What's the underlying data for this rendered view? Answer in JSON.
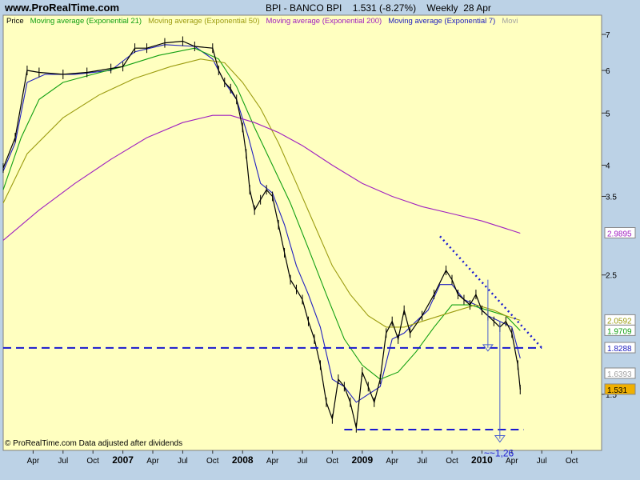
{
  "header": {
    "site": "www.ProRealTime.com",
    "title": "BPI - BANCO BPI    1.531 (-8.27%)    Weekly  28 Apr"
  },
  "legend": [
    {
      "label": "Price",
      "color": "#000000"
    },
    {
      "label": "Moving average (Exponential 21)",
      "color": "#12a012"
    },
    {
      "label": "Moving average (Exponential 50)",
      "color": "#9c9c10"
    },
    {
      "label": "Moving average (Exponential 200)",
      "color": "#a020c0"
    },
    {
      "label": "Moving average (Exponential 7)",
      "color": "#2020c0"
    },
    {
      "label": "Movi",
      "color": "#a0a0a0"
    }
  ],
  "footer": "© ProRealTime.com  Data adjusted after dividends",
  "annotation": "~~1,26",
  "price_tags": [
    {
      "label": "2.9895",
      "value": 2.9895,
      "fill": "#ffffff",
      "color": "#a020c0"
    },
    {
      "label": "2.0592",
      "value": 2.0592,
      "fill": "#ffffff",
      "color": "#9c9c10"
    },
    {
      "label": "1.9709",
      "value": 1.9709,
      "fill": "#ffffff",
      "color": "#12a012"
    },
    {
      "label": "1.8288",
      "value": 1.8288,
      "fill": "#ffffff",
      "color": "#2020c0"
    },
    {
      "label": "1.6393",
      "value": 1.6393,
      "fill": "#ffffff",
      "color": "#a0a0a0"
    },
    {
      "label": "1.531",
      "value": 1.531,
      "fill": "#f0b000",
      "color": "#000000"
    }
  ],
  "colors": {
    "background": "#ffffc0",
    "frame": "#bcd2e6",
    "annotation": "#1a1ad0"
  },
  "chart_data": {
    "type": "line",
    "scale": "log",
    "ylim": [
      1.18,
      7.6
    ],
    "y_ticks": [
      7,
      6,
      5,
      4,
      3.5,
      2.5,
      1.5
    ],
    "y_tick_labels": [
      "7",
      "6",
      "5",
      "4",
      "3.5",
      "2.5",
      "1.5"
    ],
    "x_ticks": [
      "Apr",
      "Jul",
      "Oct",
      "2007",
      "Apr",
      "Jul",
      "Oct",
      "2008",
      "Apr",
      "Jul",
      "Oct",
      "2009",
      "Apr",
      "Jul",
      "Oct",
      "2010",
      "Apr",
      "Jul",
      "Oct"
    ],
    "x_range": [
      "2006-01",
      "2010-12"
    ],
    "series": [
      {
        "name": "Price",
        "x": [
          2006.0,
          2006.1,
          2006.2,
          2006.3,
          2006.5,
          2006.7,
          2006.9,
          2007.0,
          2007.1,
          2007.2,
          2007.35,
          2007.5,
          2007.6,
          2007.75,
          2007.8,
          2007.85,
          2007.9,
          2007.95,
          2008.0,
          2008.03,
          2008.06,
          2008.1,
          2008.15,
          2008.2,
          2008.25,
          2008.3,
          2008.35,
          2008.4,
          2008.45,
          2008.5,
          2008.55,
          2008.6,
          2008.65,
          2008.7,
          2008.75,
          2008.8,
          2008.85,
          2008.9,
          2008.95,
          2009.0,
          2009.05,
          2009.1,
          2009.15,
          2009.2,
          2009.25,
          2009.3,
          2009.35,
          2009.4,
          2009.5,
          2009.6,
          2009.7,
          2009.75,
          2009.8,
          2009.85,
          2009.9,
          2009.95,
          2010.0,
          2010.05,
          2010.1,
          2010.15,
          2010.2,
          2010.25,
          2010.3,
          2010.32
        ],
        "y": [
          3.95,
          4.5,
          6.0,
          5.95,
          5.9,
          5.95,
          6.05,
          6.1,
          6.6,
          6.6,
          6.75,
          6.8,
          6.65,
          6.6,
          6.0,
          5.7,
          5.55,
          5.3,
          4.7,
          4.2,
          3.6,
          3.3,
          3.45,
          3.6,
          3.5,
          3.1,
          2.75,
          2.45,
          2.35,
          2.25,
          2.05,
          1.9,
          1.7,
          1.45,
          1.35,
          1.6,
          1.55,
          1.45,
          1.3,
          1.65,
          1.55,
          1.45,
          1.6,
          1.95,
          2.05,
          1.9,
          2.15,
          1.95,
          2.1,
          2.3,
          2.55,
          2.45,
          2.3,
          2.25,
          2.2,
          2.3,
          2.15,
          2.1,
          2.05,
          2.0,
          2.05,
          1.95,
          1.7,
          1.531
        ]
      },
      {
        "name": "Moving average (Exponential 7)",
        "x": [
          2006.0,
          2006.1,
          2006.2,
          2006.35,
          2006.6,
          2006.9,
          2007.1,
          2007.35,
          2007.6,
          2007.75,
          2007.85,
          2007.95,
          2008.05,
          2008.15,
          2008.25,
          2008.35,
          2008.45,
          2008.55,
          2008.65,
          2008.75,
          2008.85,
          2008.95,
          2009.05,
          2009.15,
          2009.25,
          2009.35,
          2009.45,
          2009.55,
          2009.65,
          2009.75,
          2009.85,
          2009.95,
          2010.05,
          2010.15,
          2010.25,
          2010.32
        ],
        "y": [
          3.9,
          4.4,
          5.7,
          5.9,
          5.9,
          6.0,
          6.5,
          6.7,
          6.65,
          6.3,
          5.7,
          5.3,
          4.5,
          3.7,
          3.55,
          3.1,
          2.6,
          2.3,
          2.0,
          1.6,
          1.55,
          1.45,
          1.5,
          1.55,
          1.9,
          1.95,
          2.05,
          2.15,
          2.4,
          2.4,
          2.25,
          2.2,
          2.1,
          2.05,
          2.0,
          1.75
        ]
      },
      {
        "name": "Moving average (Exponential 21)",
        "x": [
          2006.0,
          2006.15,
          2006.3,
          2006.5,
          2006.75,
          2007.0,
          2007.3,
          2007.6,
          2007.8,
          2007.95,
          2008.1,
          2008.25,
          2008.4,
          2008.55,
          2008.7,
          2008.85,
          2009.0,
          2009.15,
          2009.3,
          2009.45,
          2009.6,
          2009.75,
          2009.9,
          2010.05,
          2010.2,
          2010.32
        ],
        "y": [
          3.6,
          4.5,
          5.3,
          5.7,
          5.9,
          6.1,
          6.4,
          6.6,
          6.3,
          5.6,
          4.7,
          4.0,
          3.4,
          2.8,
          2.3,
          1.9,
          1.7,
          1.6,
          1.65,
          1.8,
          2.0,
          2.2,
          2.2,
          2.15,
          2.1,
          1.9709
        ]
      },
      {
        "name": "Moving average (Exponential 50)",
        "x": [
          2006.0,
          2006.2,
          2006.5,
          2006.8,
          2007.1,
          2007.4,
          2007.65,
          2007.85,
          2008.0,
          2008.15,
          2008.3,
          2008.45,
          2008.6,
          2008.75,
          2008.9,
          2009.05,
          2009.2,
          2009.35,
          2009.5,
          2009.65,
          2009.8,
          2009.95,
          2010.1,
          2010.2,
          2010.32
        ],
        "y": [
          3.4,
          4.2,
          4.9,
          5.4,
          5.8,
          6.1,
          6.3,
          6.2,
          5.7,
          5.1,
          4.4,
          3.7,
          3.1,
          2.6,
          2.3,
          2.1,
          2.0,
          2.0,
          2.05,
          2.1,
          2.15,
          2.2,
          2.15,
          2.1,
          2.0592
        ]
      },
      {
        "name": "Moving average (Exponential 200)",
        "x": [
          2006.0,
          2006.3,
          2006.6,
          2006.9,
          2007.2,
          2007.5,
          2007.75,
          2007.9,
          2008.1,
          2008.3,
          2008.5,
          2008.75,
          2009.0,
          2009.25,
          2009.5,
          2009.75,
          2010.0,
          2010.2,
          2010.32
        ],
        "y": [
          2.9,
          3.3,
          3.7,
          4.1,
          4.5,
          4.8,
          4.95,
          4.95,
          4.8,
          4.6,
          4.35,
          4.0,
          3.7,
          3.5,
          3.35,
          3.25,
          3.15,
          3.05,
          2.9895
        ]
      }
    ],
    "support_lines": [
      {
        "y": 1.83,
        "x_start": 2006.0,
        "x_end": 2010.5
      },
      {
        "y": 1.29,
        "x_start": 2008.85,
        "x_end": 2010.35
      }
    ],
    "trend_line": {
      "x": [
        2009.65,
        2010.5
      ],
      "y": [
        2.95,
        1.83
      ]
    }
  }
}
